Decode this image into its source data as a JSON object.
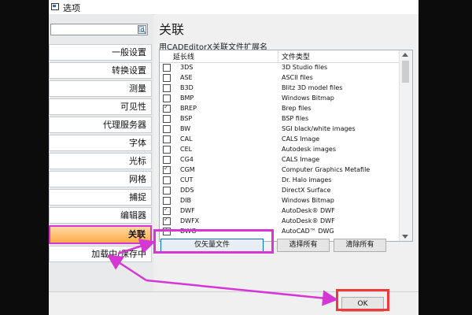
{
  "window": {
    "title": "选项"
  },
  "sidebar": {
    "search_placeholder": "",
    "items": [
      {
        "label": "一般设置"
      },
      {
        "label": "转换设置"
      },
      {
        "label": "测量"
      },
      {
        "label": "可见性"
      },
      {
        "label": "代理服务器"
      },
      {
        "label": "字体"
      },
      {
        "label": "光标"
      },
      {
        "label": "网格"
      },
      {
        "label": "捕捉"
      },
      {
        "label": "编辑器"
      },
      {
        "label": "关联",
        "active": true
      },
      {
        "label": "加载中/保存中"
      }
    ]
  },
  "panel": {
    "title": "关联",
    "group_label": "用CADEditorX关联文件扩展名",
    "columns": {
      "ext": "延长线",
      "type": "文件类型"
    },
    "rows": [
      {
        "ext": "3DS",
        "type": "3D Studio files",
        "checked": false
      },
      {
        "ext": "ASE",
        "type": "ASCII files",
        "checked": false
      },
      {
        "ext": "B3D",
        "type": "Blitz 3D model files",
        "checked": false
      },
      {
        "ext": "BMP",
        "type": "Windows Bitmap",
        "checked": false
      },
      {
        "ext": "BREP",
        "type": "Brep files",
        "checked": true
      },
      {
        "ext": "BSP",
        "type": "BSP files",
        "checked": false
      },
      {
        "ext": "BW",
        "type": "SGI black/white images",
        "checked": false
      },
      {
        "ext": "CAL",
        "type": "CALS Image",
        "checked": false
      },
      {
        "ext": "CEL",
        "type": "Autodesk images",
        "checked": false
      },
      {
        "ext": "CG4",
        "type": "CALS Image",
        "checked": false
      },
      {
        "ext": "CGM",
        "type": "Computer Graphics Metafile",
        "checked": true
      },
      {
        "ext": "CUT",
        "type": "Dr. Halo images",
        "checked": false
      },
      {
        "ext": "DDS",
        "type": "DirectX Surface",
        "checked": false
      },
      {
        "ext": "DIB",
        "type": "Windows Bitmap",
        "checked": false
      },
      {
        "ext": "DWF",
        "type": "AutoDesk® DWF",
        "checked": true
      },
      {
        "ext": "DWFX",
        "type": "AutoDesk® DWF",
        "checked": true
      },
      {
        "ext": "DWG",
        "type": "AutoCAD™ DWG",
        "checked": true
      }
    ],
    "buttons": {
      "vector_only": "仅矢量文件",
      "select_all": "选择所有",
      "clear_all": "清除所有"
    }
  },
  "footer": {
    "ok": "OK"
  },
  "colors": {
    "highlight_magenta": "#d437d4",
    "highlight_red": "#f23939",
    "active_item": "#ffad4a"
  },
  "icons": [
    "window-icon",
    "search-icon",
    "checkbox",
    "scroll-up-arrow",
    "scroll-down-arrow"
  ]
}
